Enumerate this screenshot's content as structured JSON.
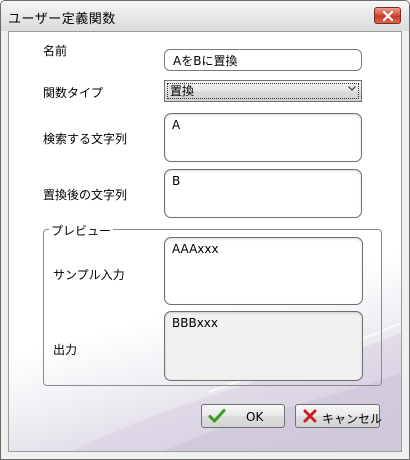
{
  "window": {
    "title": "ユーザー定義関数"
  },
  "form": {
    "name_label": "名前",
    "name_value": "AをBに置換",
    "function_type_label": "関数タイプ",
    "function_type_value": "置換",
    "search_label": "検索する文字列",
    "search_value": "A",
    "replace_label": "置換後の文字列",
    "replace_value": "B"
  },
  "preview": {
    "title": "プレビュー",
    "sample_label": "サンプル入力",
    "sample_value": "AAAxxx",
    "output_label": "出力",
    "output_value": "BBBxxx"
  },
  "buttons": {
    "ok_label": "OK",
    "cancel_label": "キャンセル"
  },
  "colors": {
    "ok_icon": "#3a9a1e",
    "cancel_icon": "#cc1f1f",
    "close_button": "#c94a33"
  },
  "icons": {
    "close": "close-icon",
    "dropdown": "chevron-down-icon",
    "ok": "checkmark-icon",
    "cancel": "x-icon"
  }
}
